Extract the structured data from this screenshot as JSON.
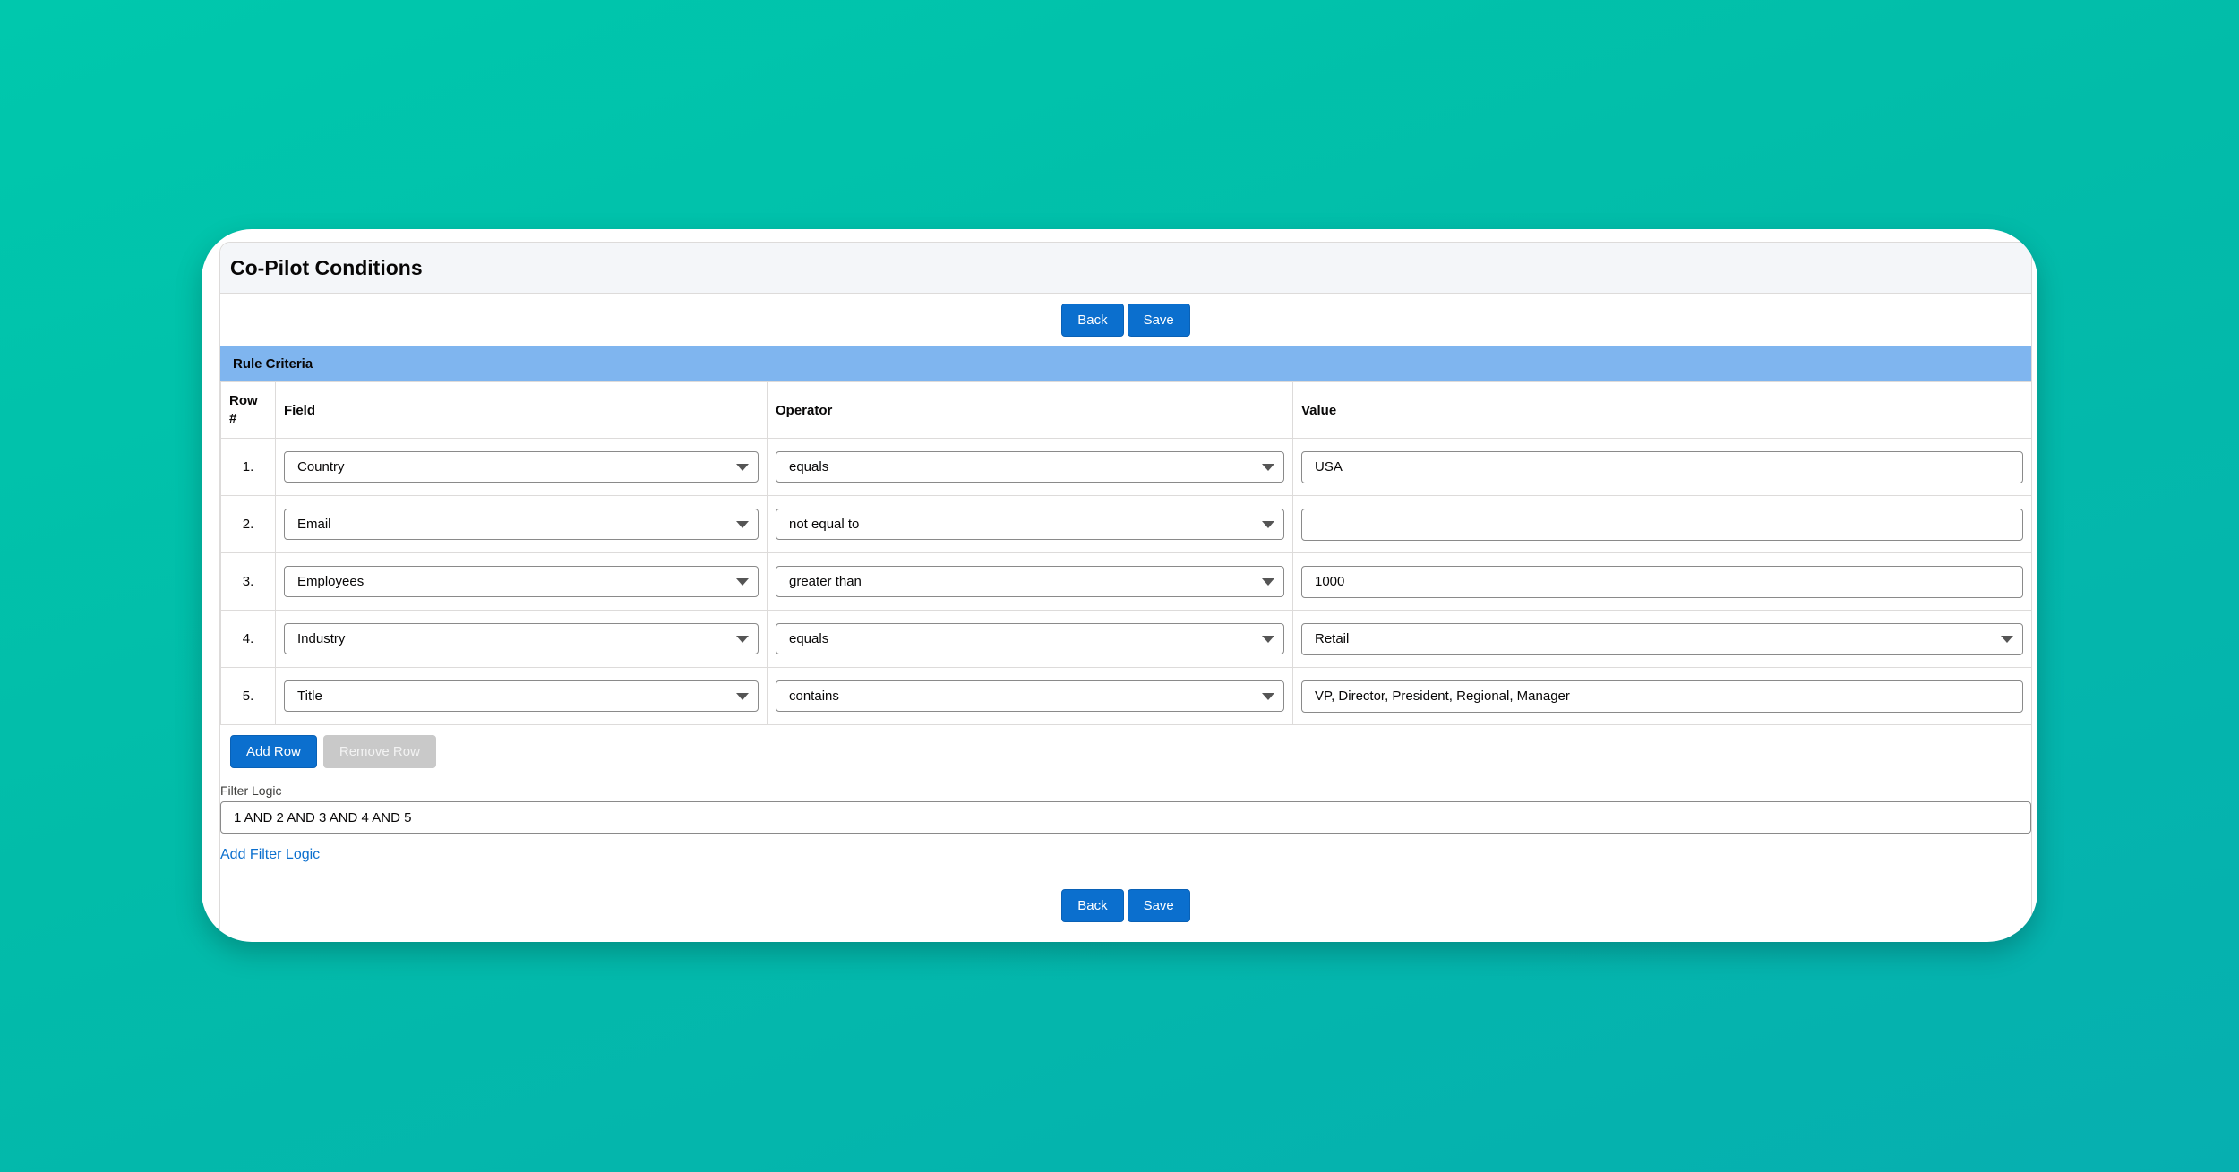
{
  "page": {
    "title": "Co-Pilot Conditions"
  },
  "toolbar": {
    "back_label": "Back",
    "save_label": "Save"
  },
  "section": {
    "title": "Rule Criteria"
  },
  "table": {
    "headers": {
      "row": "Row #",
      "field": "Field",
      "operator": "Operator",
      "value": "Value"
    },
    "rows": [
      {
        "num": "1.",
        "field": "Country",
        "operator": "equals",
        "value": "USA"
      },
      {
        "num": "2.",
        "field": "Email",
        "operator": "not equal to",
        "value": ""
      },
      {
        "num": "3.",
        "field": "Employees",
        "operator": "greater than",
        "value": "1000"
      },
      {
        "num": "4.",
        "field": "Industry",
        "operator": "equals",
        "value": "Retail"
      },
      {
        "num": "5.",
        "field": "Title",
        "operator": "contains",
        "value": "VP, Director, President, Regional, Manager"
      }
    ]
  },
  "row_actions": {
    "add_label": "Add Row",
    "remove_label": "Remove Row"
  },
  "filter_logic": {
    "label": "Filter Logic",
    "value": "1 AND 2 AND 3 AND 4 AND 5",
    "add_link": "Add Filter Logic"
  },
  "colors": {
    "brand_button": "#0b6fce",
    "section_bar": "#7fb5ef",
    "background_gradient_start": "#00c8ad",
    "background_gradient_end": "#06afb0"
  },
  "icons": {
    "dropdown": "chevron-down-icon"
  }
}
